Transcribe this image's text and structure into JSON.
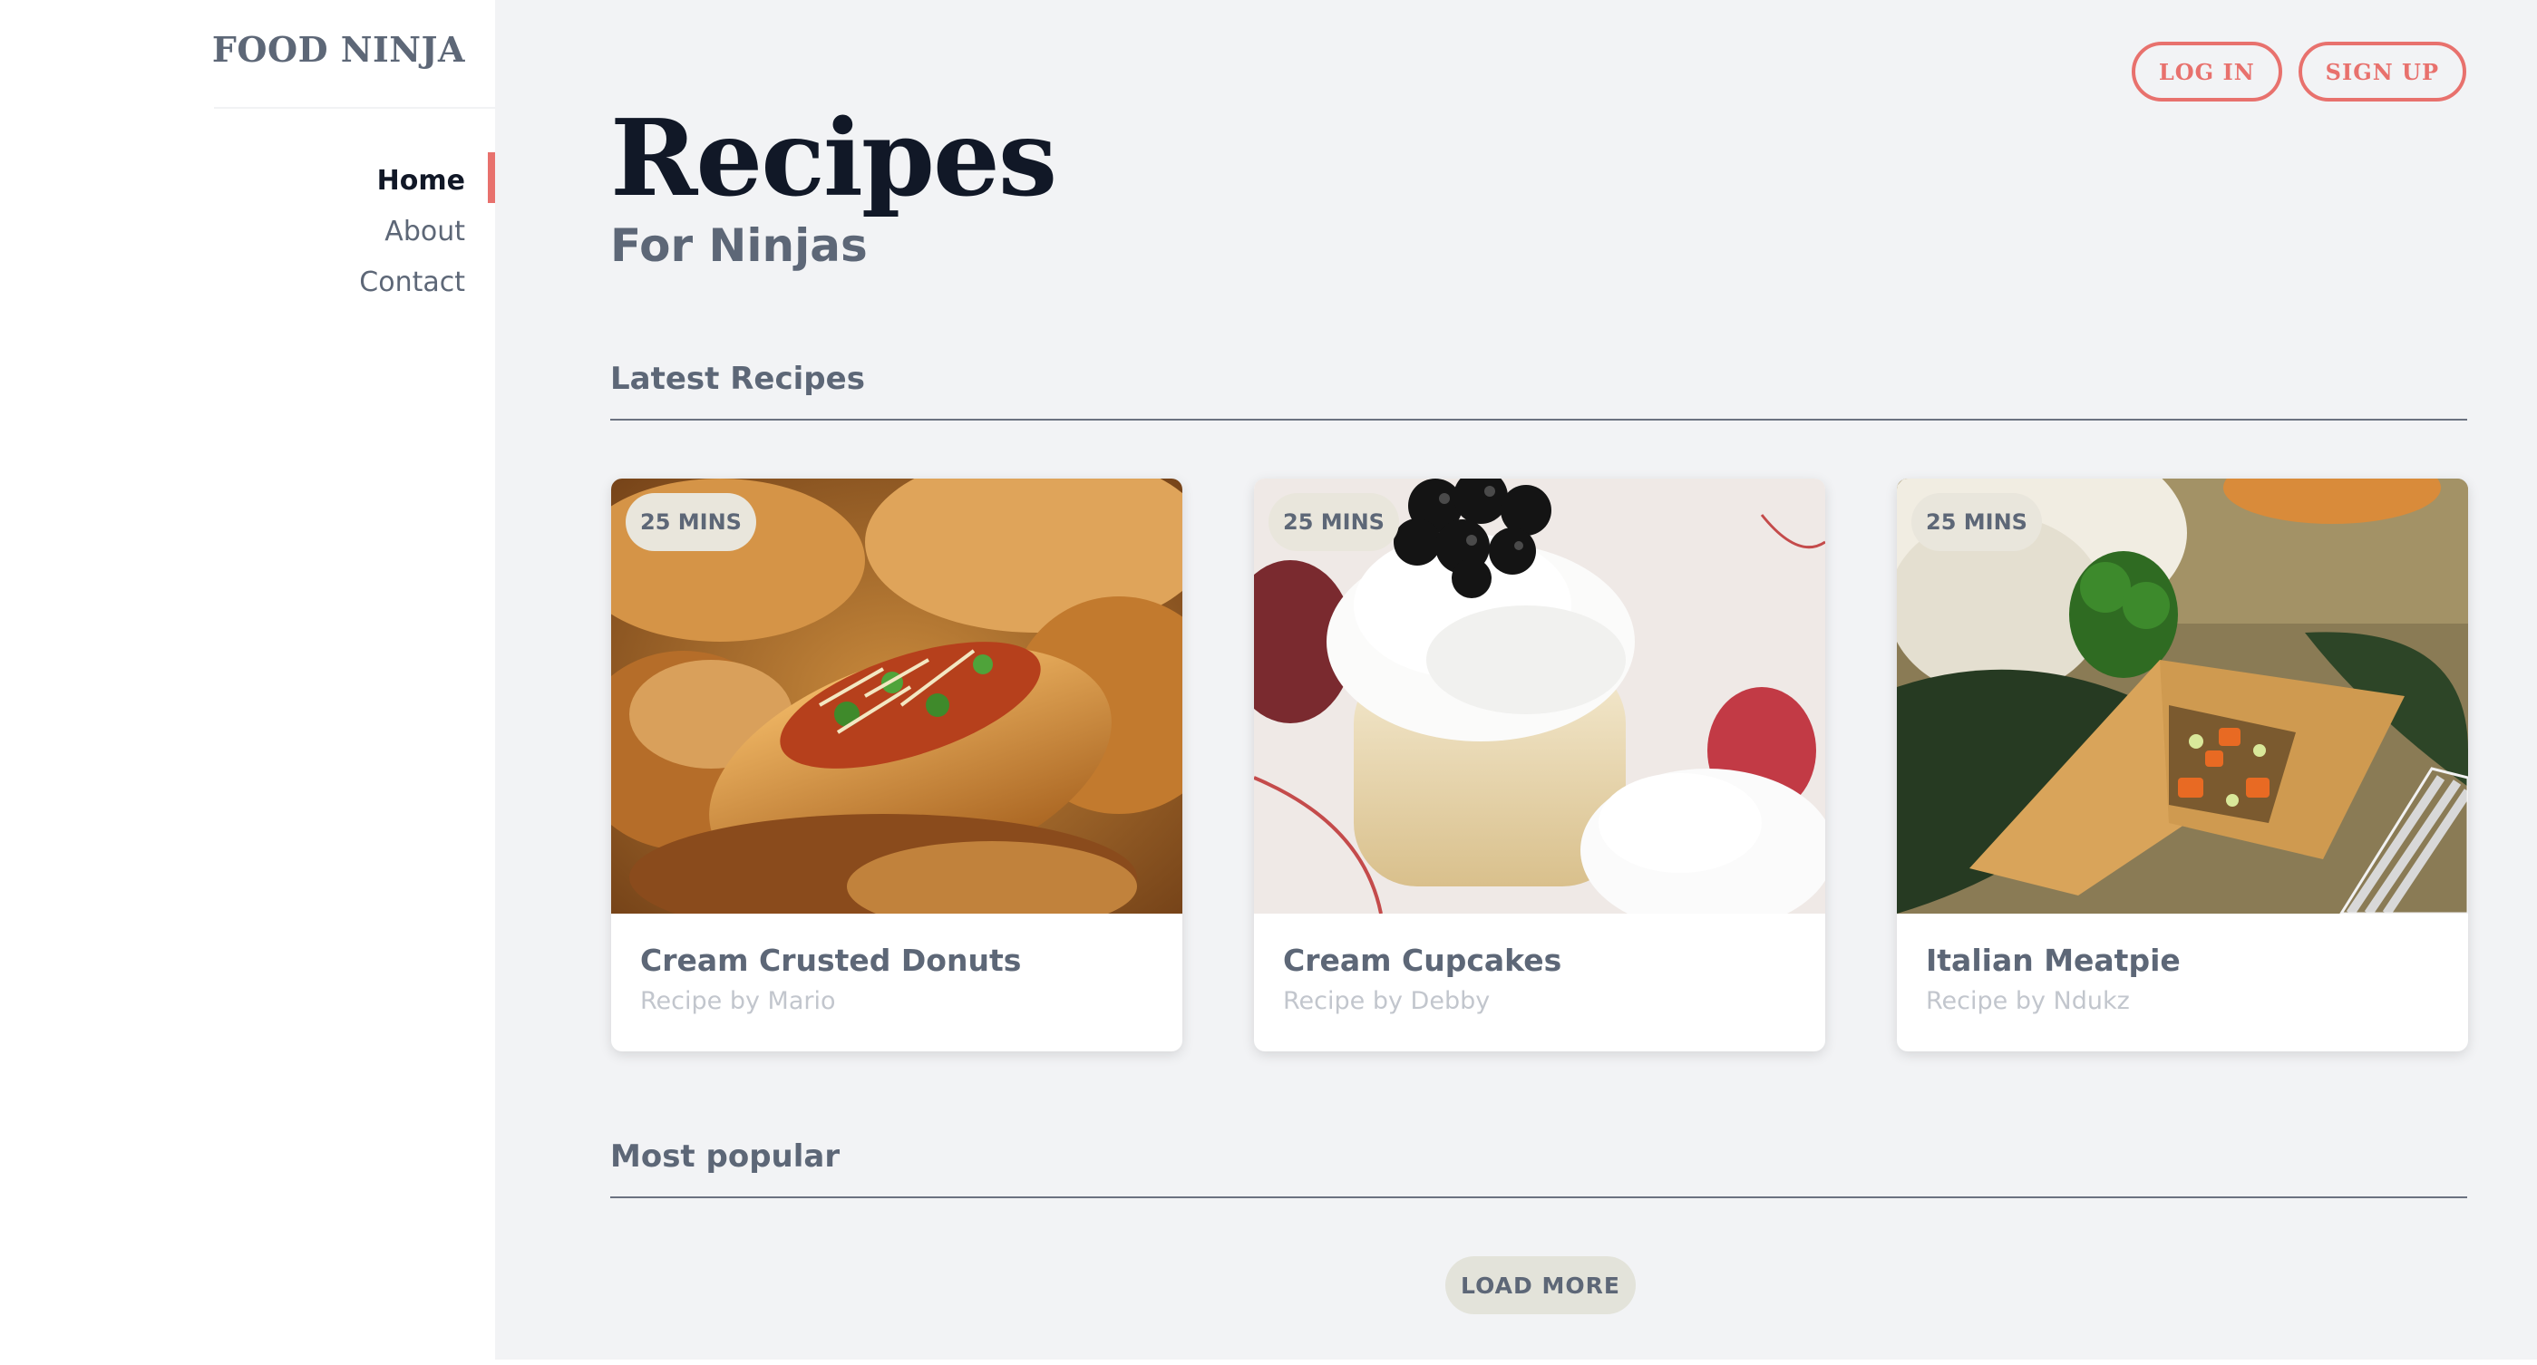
{
  "sidebar": {
    "brand": "FOOD NINJA",
    "nav": [
      {
        "label": "Home",
        "active": true
      },
      {
        "label": "About",
        "active": false
      },
      {
        "label": "Contact",
        "active": false
      }
    ]
  },
  "header": {
    "login_label": "LOG IN",
    "signup_label": "SIGN UP"
  },
  "hero": {
    "title": "Recipes",
    "subtitle": "For Ninjas"
  },
  "sections": {
    "latest_title": "Latest Recipes",
    "popular_title": "Most popular"
  },
  "recipes": [
    {
      "time": "25 MINS",
      "title": "Cream Crusted Donuts",
      "author": "Recipe by Mario",
      "image": "bread-rolls-photo"
    },
    {
      "time": "25 MINS",
      "title": "Cream Cupcakes",
      "author": "Recipe by Debby",
      "image": "cheesecake-photo"
    },
    {
      "time": "25 MINS",
      "title": "Italian Meatpie",
      "author": "Recipe by Ndukz",
      "image": "meatpie-photo"
    }
  ],
  "load_more_label": "LOAD MORE",
  "colors": {
    "accent": "#e8716d",
    "heading": "#111827",
    "muted": "#5d6777",
    "background": "#f2f3f5"
  }
}
